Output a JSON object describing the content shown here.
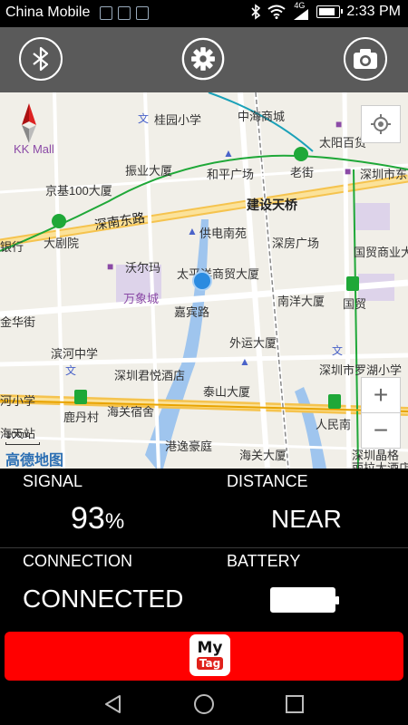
{
  "status_bar": {
    "carrier": "China Mobile",
    "network": "4G",
    "time": "2:33 PM"
  },
  "toolbar": {
    "left": "bluetooth-icon",
    "center": "gear-icon",
    "right": "camera-icon"
  },
  "map": {
    "brand": "高德地图",
    "scale": "100m",
    "zoom_in": "+",
    "zoom_out": "−",
    "labels": [
      {
        "name": "label-guiyuan-school",
        "text": "桂园小学",
        "cls": "map-label"
      },
      {
        "name": "label-zhonghai-mall",
        "text": "中海商城",
        "cls": "map-label"
      },
      {
        "name": "label-taiyang-baihuo",
        "text": "太阳百货",
        "cls": "map-label"
      },
      {
        "name": "label-laojie",
        "text": "老街",
        "cls": "map-label"
      },
      {
        "name": "label-shenzhen-shidong",
        "text": "深圳市东",
        "cls": "map-label"
      },
      {
        "name": "label-kk-mall",
        "text": "KK Mall",
        "cls": "map-label purple"
      },
      {
        "name": "label-zhenye-building",
        "text": "振业大厦",
        "cls": "map-label"
      },
      {
        "name": "label-heping-square",
        "text": "和平广场",
        "cls": "map-label"
      },
      {
        "name": "label-jingji-100",
        "text": "京基100大厦",
        "cls": "map-label"
      },
      {
        "name": "label-gongdian-nanyuan",
        "text": "供电南苑",
        "cls": "map-label"
      },
      {
        "name": "label-dajuyuan",
        "text": "大剧院",
        "cls": "map-label"
      },
      {
        "name": "label-yinhang",
        "text": "银行",
        "cls": "map-label"
      },
      {
        "name": "label-shenyang-square",
        "text": "深房广场",
        "cls": "map-label"
      },
      {
        "name": "label-guomao-shangye",
        "text": "国贸商业大",
        "cls": "map-label"
      },
      {
        "name": "label-woerma",
        "text": "沃尔玛",
        "cls": "map-label"
      },
      {
        "name": "label-taiping-shangmao",
        "text": "太平洋商贸大厦",
        "cls": "map-label"
      },
      {
        "name": "label-wanxiangcheng",
        "text": "万象城",
        "cls": "map-label purple"
      },
      {
        "name": "label-nanyang-building",
        "text": "南洋大厦",
        "cls": "map-label"
      },
      {
        "name": "label-guomao",
        "text": "国贸",
        "cls": "map-label"
      },
      {
        "name": "label-jinhuajie",
        "text": "金华街",
        "cls": "map-label"
      },
      {
        "name": "label-jiabin-lu",
        "text": "嘉宾路",
        "cls": "map-label"
      },
      {
        "name": "label-waimao-building",
        "text": "外运大厦",
        "cls": "map-label"
      },
      {
        "name": "label-binhe-school",
        "text": "滨河中学",
        "cls": "map-label"
      },
      {
        "name": "label-shenzhen-junyue",
        "text": "深圳君悦酒店",
        "cls": "map-label"
      },
      {
        "name": "label-luohu-school",
        "text": "深圳市罗湖小学",
        "cls": "map-label"
      },
      {
        "name": "label-xiaoxue",
        "text": "河小学",
        "cls": "map-label"
      },
      {
        "name": "label-taishan-building",
        "text": "泰山大厦",
        "cls": "map-label"
      },
      {
        "name": "label-luduncun",
        "text": "鹿丹村",
        "cls": "map-label"
      },
      {
        "name": "label-haiguan-suse",
        "text": "海关宿舍",
        "cls": "map-label"
      },
      {
        "name": "label-renmin-nan",
        "text": "人民南",
        "cls": "map-label"
      },
      {
        "name": "label-haitian",
        "text": "海天站",
        "cls": "map-label"
      },
      {
        "name": "label-gangyi-home",
        "text": "港逸豪庭",
        "cls": "map-label"
      },
      {
        "name": "label-haiguan-building",
        "text": "海关大厦",
        "cls": "map-label"
      },
      {
        "name": "label-shenzhen-jingge",
        "text": "深圳晶格",
        "cls": "map-label"
      },
      {
        "name": "label-wang-dajiudian",
        "text": "丽拉大酒店",
        "cls": "map-label"
      }
    ],
    "roads": [
      {
        "name": "road-label-jianshe",
        "text": "建设天桥"
      },
      {
        "name": "road-label-shennan",
        "text": "深南东路"
      }
    ]
  },
  "stats": {
    "signal_label": "SIGNAL",
    "signal_value": "93",
    "signal_unit": "%",
    "distance_label": "DISTANCE",
    "distance_value": "NEAR",
    "connection_label": "CONNECTION",
    "connection_value": "CONNECTED",
    "battery_label": "BATTERY",
    "battery_level": 1.0
  },
  "logo": {
    "line1": "My",
    "line2": "Tag"
  },
  "colors": {
    "toolbar": "#5a5a5a",
    "accent": "#ff0000",
    "location_dot": "#2b8be0"
  }
}
